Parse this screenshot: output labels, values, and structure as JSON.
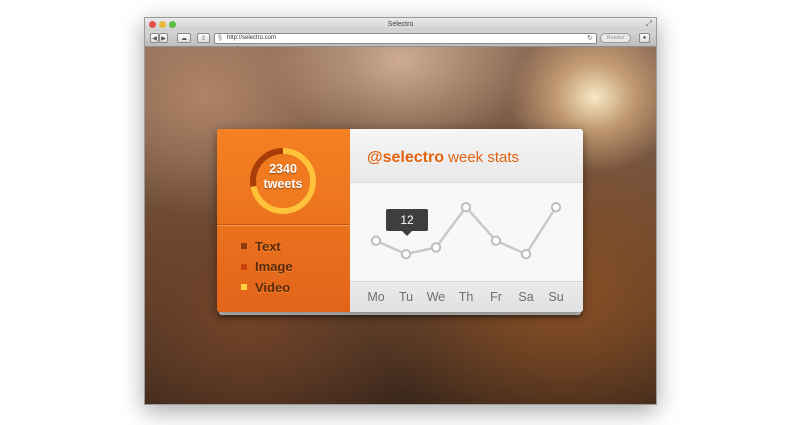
{
  "window": {
    "title": "Selectro"
  },
  "toolbar": {
    "url": "http://selectro.com",
    "reader_label": "Reader"
  },
  "widget": {
    "ring": {
      "count": "2340",
      "unit": "tweets",
      "fraction": 0.72,
      "colors": {
        "track": "#a83d08",
        "fill": "#ffc23a"
      }
    },
    "legend": [
      {
        "label": "Text",
        "color": "#8b3a0b"
      },
      {
        "label": "Image",
        "color": "#c7420c"
      },
      {
        "label": "Video",
        "color": "#ffd040"
      }
    ],
    "header": {
      "handle": "@selectro",
      "subtitle": "week stats"
    },
    "tooltip": {
      "value": "12",
      "day_index": 1
    },
    "accent": "#e2620f"
  },
  "chart_data": {
    "type": "line",
    "categories": [
      "Mo",
      "Tu",
      "We",
      "Th",
      "Fr",
      "Sa",
      "Su"
    ],
    "series": [
      {
        "values": [
          13,
          12,
          12.5,
          15.5,
          13,
          12,
          15.5
        ]
      }
    ],
    "ylim": [
      10,
      17
    ]
  }
}
